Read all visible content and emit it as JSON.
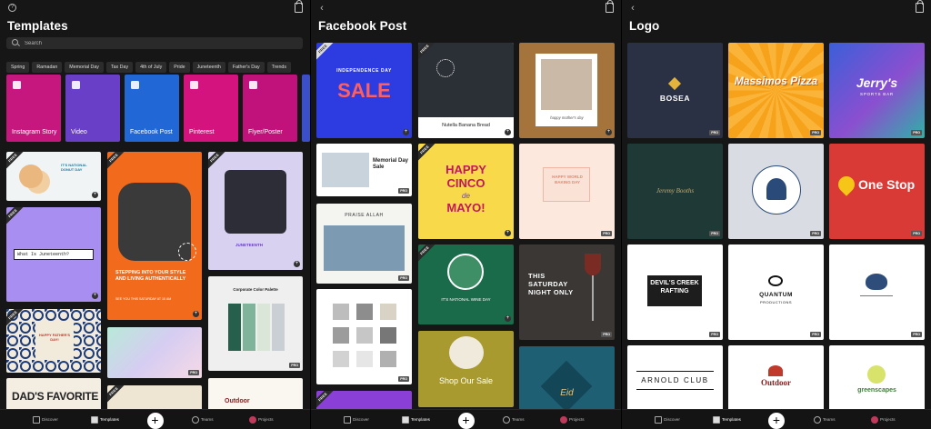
{
  "pane1": {
    "title": "Templates",
    "search_placeholder": "Search",
    "chips": [
      "Spring",
      "Ramadan",
      "Memorial Day",
      "Tax Day",
      "4th of July",
      "Pride",
      "Juneteenth",
      "Father's Day",
      "Trends"
    ],
    "categories": [
      {
        "label": "Instagram Story",
        "color": "#c6177f"
      },
      {
        "label": "Video",
        "color": "#6a3fc8"
      },
      {
        "label": "Facebook Post",
        "color": "#2168d6"
      },
      {
        "label": "Pinterest",
        "color": "#d4137e"
      },
      {
        "label": "Flyer/Poster",
        "color": "#c0127a"
      }
    ],
    "cards": {
      "donut_text": "IT'S NATIONAL DONUT DAY",
      "juneteenth_q": "What Is Juneteenth?",
      "stepping": "STEPPING INTO YOUR STYLE AND LIVING AUTHENTICALLY",
      "see_you": "SEE YOU THIS SATURDAY AT 10 AM",
      "juneteenth_tag": "JUNETEENTH",
      "palette_title": "Corporate Color Palette",
      "happy_fathers": "HAPPY FATHER'S DAY!",
      "dads_favorite": "DAD'S FAVORITE",
      "outdoor": "Outdoor",
      "free": "FREE",
      "pro": "PRO"
    }
  },
  "pane2": {
    "title": "Facebook Post",
    "cards": {
      "independence": "INDEPENDENCE DAY",
      "sale": "SALE",
      "nutella": "Nutella Banana Bread",
      "mothers": "happy mother's day",
      "memorial": "Memorial Day Sale",
      "happy": "HAPPY",
      "cinco": "CINCO",
      "de": "de",
      "mayo": "MAYO!",
      "world_baking": "HAPPY WORLD BAKING DAY",
      "praise": "PRAISE ALLAH",
      "wine_day": "IT'S NATIONAL WINE DAY",
      "saturday": "THIS SATURDAY NIGHT ONLY",
      "shop": "Shop Our Sale",
      "eid": "Eid",
      "free": "FREE",
      "pro": "PRO"
    }
  },
  "pane3": {
    "title": "Logo",
    "cards": {
      "bosea": "BOSEA",
      "massimos": "Massimos Pizza",
      "jerrys": "Jerry's",
      "sports_bar": "SPORTS BAR",
      "jeremy": "Jeremy Booths",
      "onestop": "One Stop",
      "devils": "DEVIL'S CREEK RAFTING",
      "quantum": "QUANTUM",
      "productions": "PRODUCTIONS",
      "arnold": "ARNOLD CLUB",
      "outdoor": "Outdoor",
      "greenscapes": "greenscapes",
      "pro": "PRO"
    }
  },
  "nav": {
    "discover": "Discover",
    "templates": "Templates",
    "teams": "Teams",
    "projects": "Projects",
    "create": "+"
  }
}
